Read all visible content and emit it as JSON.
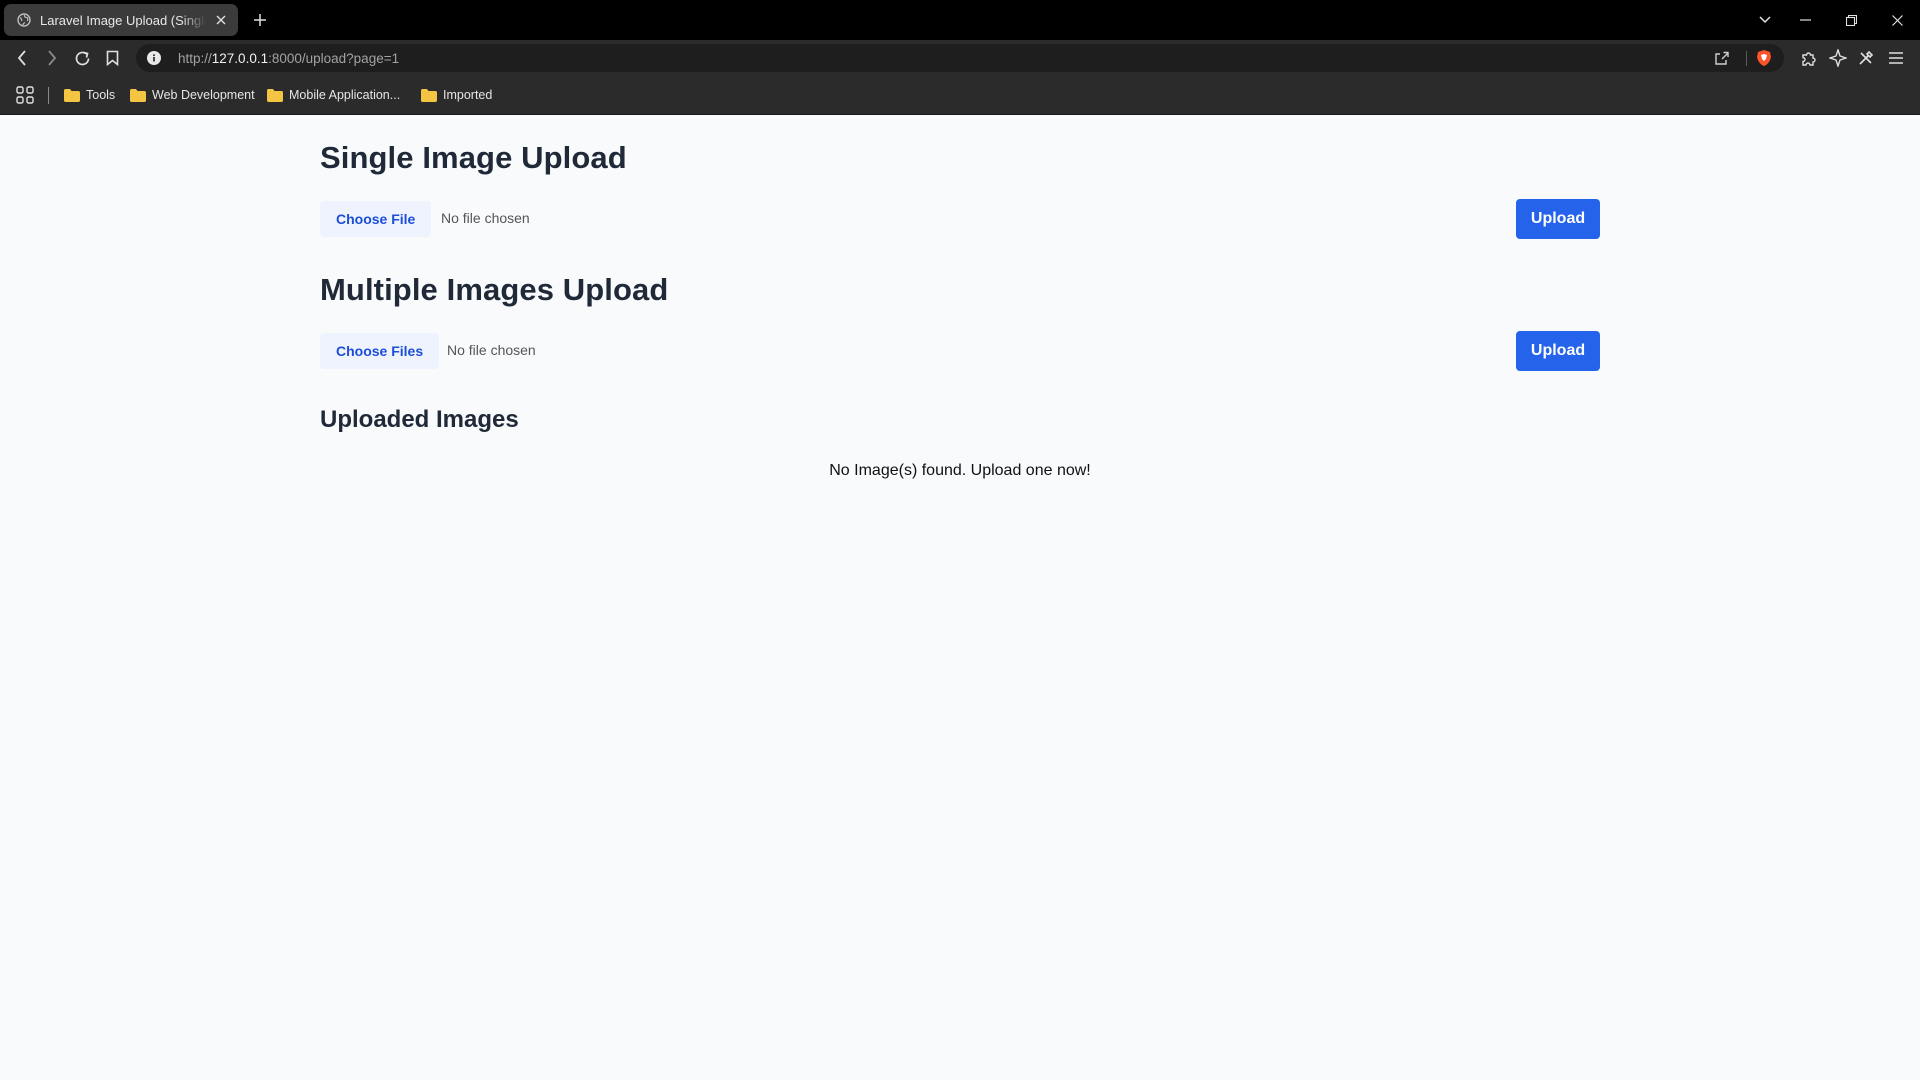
{
  "browser": {
    "tab_title": "Laravel Image Upload (Single +",
    "url_scheme": "http://",
    "url_host": "127.0.0.1",
    "url_rest": ":8000/upload?page=1",
    "bookmarks": [
      {
        "label": "Tools"
      },
      {
        "label": "Web Development"
      },
      {
        "label": "Mobile Application..."
      },
      {
        "label": "Imported"
      }
    ],
    "colors": {
      "folder": "#f4c542",
      "brave": "#fb542b"
    }
  },
  "single": {
    "title": "Single Image Upload",
    "choose_label": "Choose File",
    "status": "No file chosen",
    "upload_label": "Upload"
  },
  "multiple": {
    "title": "Multiple Images Upload",
    "choose_label": "Choose Files",
    "status": "No file chosen",
    "upload_label": "Upload"
  },
  "uploaded": {
    "title": "Uploaded Images",
    "empty_message": "No Image(s) found. Upload one now!"
  },
  "theme": {
    "primary": "#2563eb",
    "choose_bg": "#eef3fd",
    "heading": "#1f2937",
    "page_bg": "#f8fafc"
  }
}
